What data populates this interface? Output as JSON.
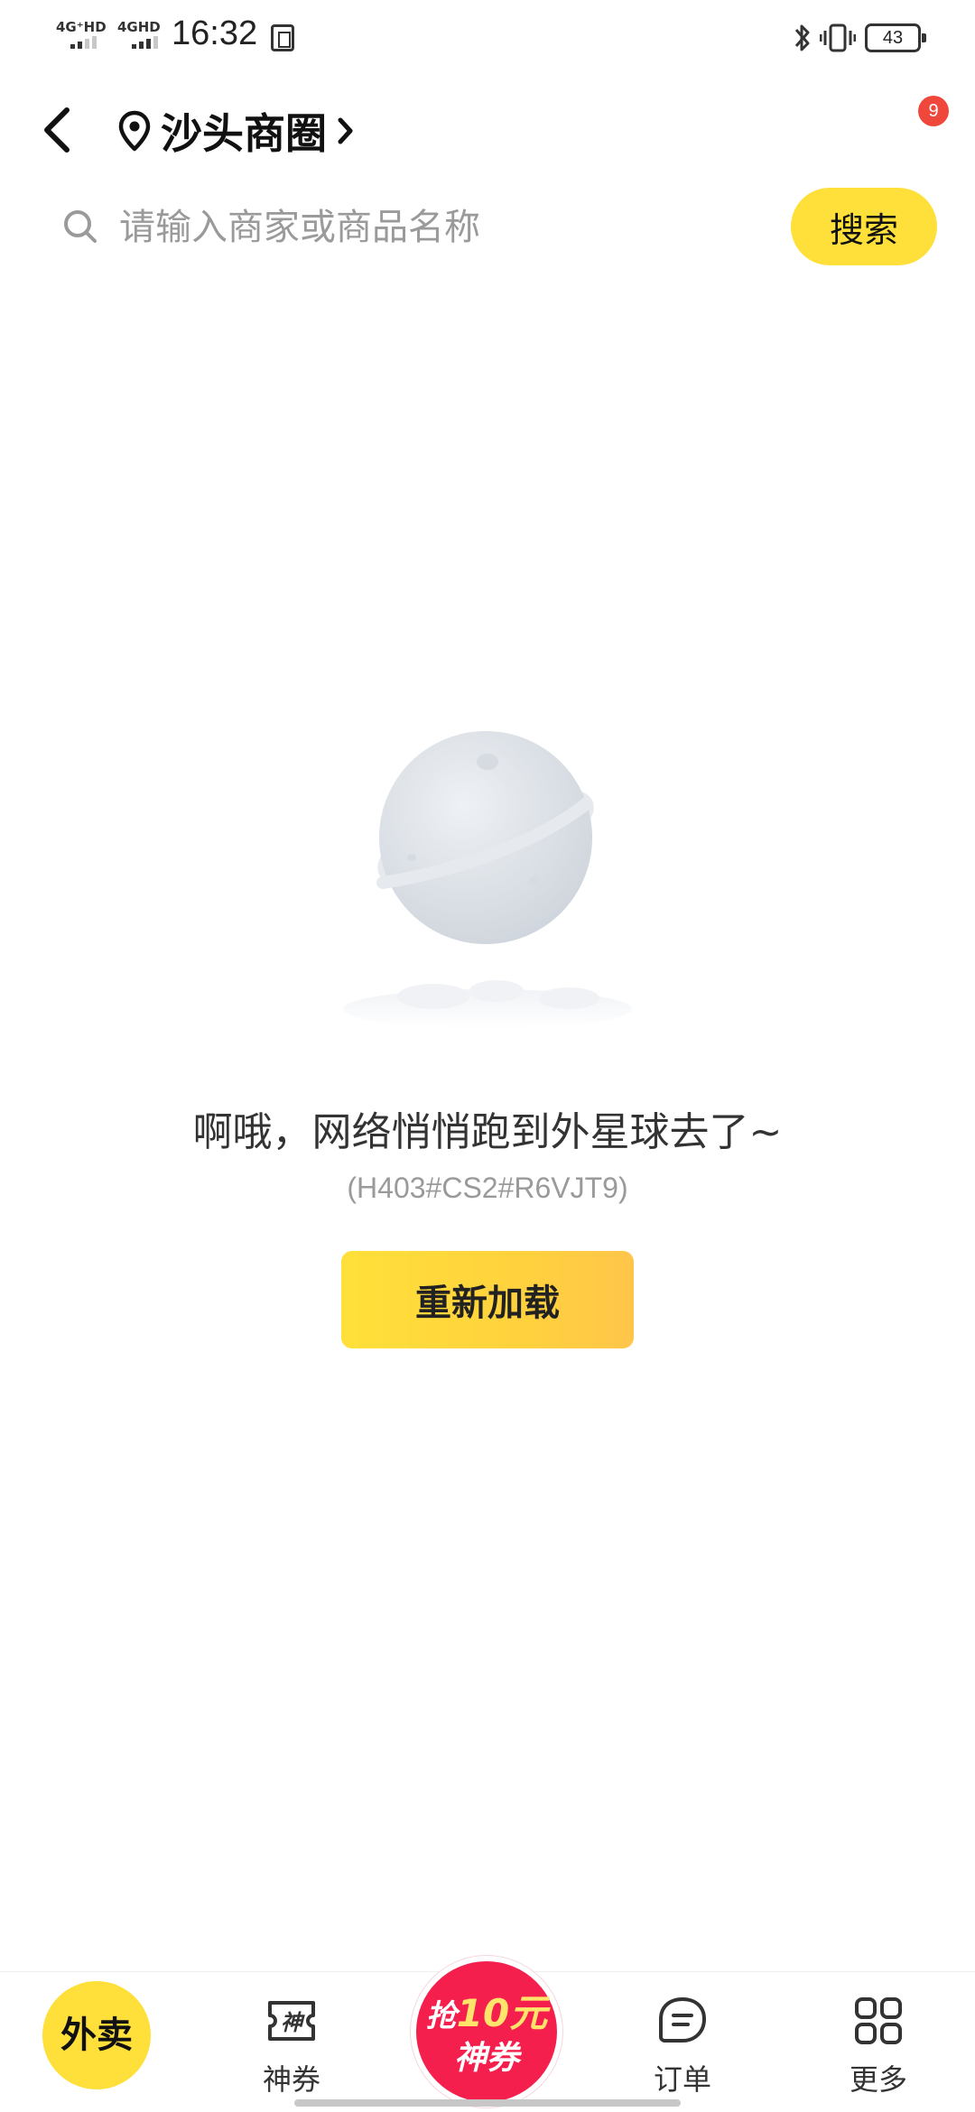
{
  "status_bar": {
    "network_1": "4G⁺HD",
    "network_2": "4GHD",
    "time": "16:32",
    "battery": "43"
  },
  "header": {
    "location_name": "沙头商圈",
    "notification_count": "9"
  },
  "search": {
    "placeholder": "请输入商家或商品名称",
    "button_label": "搜索"
  },
  "empty_state": {
    "message": "啊哦，网络悄悄跑到外星球去了~",
    "error_code": "(H403#CS2#R6VJT9)",
    "reload_label": "重新加载"
  },
  "tabbar": {
    "home_label": "外卖",
    "coupon_label": "神券",
    "promo_prefix": "抢",
    "promo_amount": "10元",
    "promo_suffix": "神券",
    "orders_label": "订单",
    "more_label": "更多"
  },
  "colors": {
    "accent_yellow": "#ffe03a",
    "promo_red": "#f51f4d",
    "badge_red": "#f0473d"
  },
  "icons": [
    "back-icon",
    "location-pin-icon",
    "chevron-right-icon",
    "search-icon",
    "bluetooth-icon",
    "vibrate-icon",
    "battery-icon",
    "planet-illustration",
    "coupon-icon",
    "orders-icon",
    "grid-icon"
  ]
}
